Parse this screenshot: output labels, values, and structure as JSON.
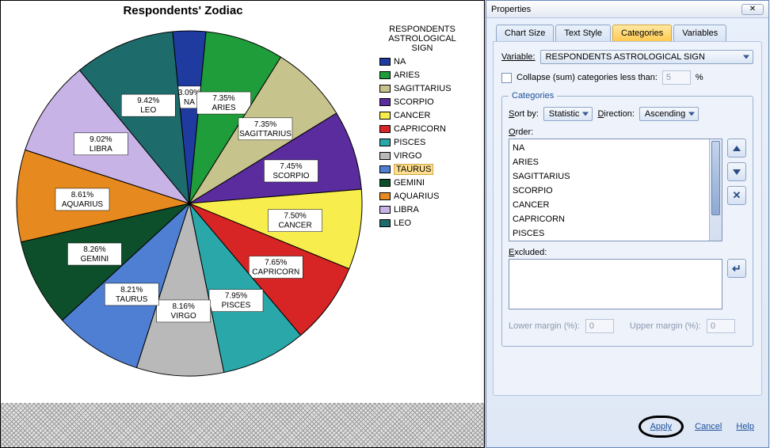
{
  "chart_data": {
    "type": "pie",
    "title": "Respondents' Zodiac",
    "legend_title": [
      "RESPONDENTS",
      "ASTROLOGICAL",
      "SIGN"
    ],
    "slices": [
      {
        "label": "NA",
        "value": 3.09,
        "color": "#1f3ba0",
        "display": "3.09%\nNA"
      },
      {
        "label": "ARIES",
        "value": 7.35,
        "color": "#1f9d3a",
        "display": "7.35%\nARIES"
      },
      {
        "label": "SAGITTARIUS",
        "value": 7.35,
        "color": "#c7c38c",
        "display": "7.35%\nSAGITTARIUS"
      },
      {
        "label": "SCORPIO",
        "value": 7.45,
        "color": "#5a2c9d",
        "display": "7.45%\nSCORPIO"
      },
      {
        "label": "CANCER",
        "value": 7.5,
        "color": "#f7ee4e",
        "display": "7.50%\nCANCER"
      },
      {
        "label": "CAPRICORN",
        "value": 7.65,
        "color": "#d72424",
        "display": "7.65%\nCAPRICORN"
      },
      {
        "label": "PISCES",
        "value": 7.95,
        "color": "#2aa7a9",
        "display": "7.95%\nPISCES"
      },
      {
        "label": "VIRGO",
        "value": 8.16,
        "color": "#b9b9b9",
        "display": "8.16%\nVIRGO"
      },
      {
        "label": "TAURUS",
        "value": 8.21,
        "color": "#4f7fd2",
        "display": "8.21%\nTAURUS"
      },
      {
        "label": "GEMINI",
        "value": 8.26,
        "color": "#0d4f2a",
        "display": "8.26%\nGEMINI"
      },
      {
        "label": "AQUARIUS",
        "value": 8.61,
        "color": "#e68a1f",
        "display": "8.61%\nAQUARIUS"
      },
      {
        "label": "LIBRA",
        "value": 9.02,
        "color": "#c8b3e6",
        "display": "9.02%\nLIBRA"
      },
      {
        "label": "LEO",
        "value": 9.42,
        "color": "#1e6b6c",
        "display": "9.42%\nLEO"
      }
    ]
  },
  "panel": {
    "title": "Properties",
    "tabs": {
      "chart_size": "Chart Size",
      "text_style": "Text Style",
      "categories": "Categories",
      "variables": "Variables"
    },
    "variable_label": "Variable:",
    "variable_value": "RESPONDENTS ASTROLOGICAL SIGN",
    "collapse_label": "Collapse (sum) categories less than:",
    "collapse_value": "5",
    "collapse_suffix": "%",
    "cats_legend": "Categories",
    "sort_by_label": "Sort by:",
    "sort_by_value": "Statistic",
    "direction_label": "Direction:",
    "direction_value": "Ascending",
    "order_label": "Order:",
    "order_items": [
      "NA",
      "ARIES",
      "SAGITTARIUS",
      "SCORPIO",
      "CANCER",
      "CAPRICORN",
      "PISCES"
    ],
    "excluded_label": "Excluded:",
    "lower_margin_label": "Lower margin (%):",
    "lower_margin_value": "0",
    "upper_margin_label": "Upper margin (%):",
    "upper_margin_value": "0",
    "apply": "Apply",
    "cancel": "Cancel",
    "help": "Help",
    "close_glyph": "✕"
  }
}
